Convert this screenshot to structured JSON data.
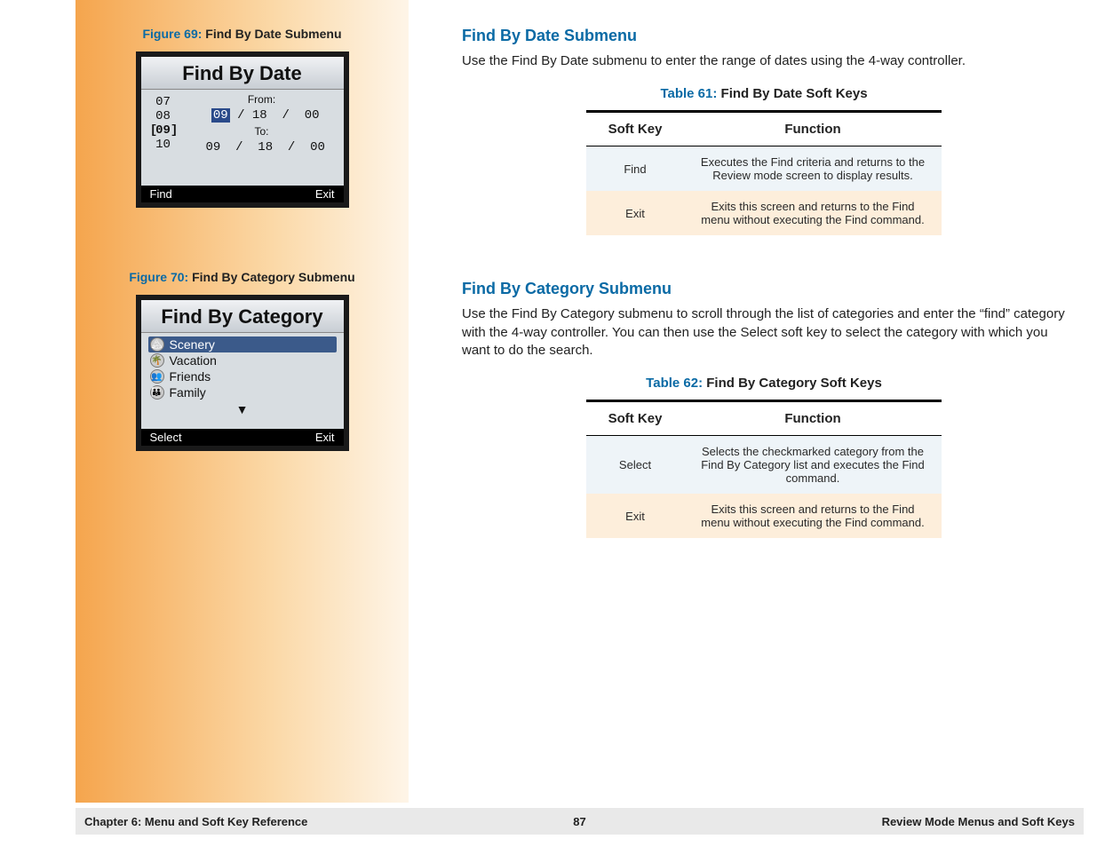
{
  "sidebar": {
    "figure69": {
      "label": "Figure 69:",
      "title": "Find By Date Submenu"
    },
    "figure70": {
      "label": "Figure 70:",
      "title": "Find By Category Submenu"
    },
    "screen1": {
      "title": "Find By Date",
      "wheel": [
        "07",
        "08",
        "09",
        "10"
      ],
      "from_label": "From:",
      "to_label": "To:",
      "from_date": {
        "m": "09",
        "d": "18",
        "y": "00"
      },
      "to_date": {
        "m": "09",
        "d": "18",
        "y": "00"
      },
      "sep": "/",
      "left_key": "Find",
      "right_key": "Exit"
    },
    "screen2": {
      "title": "Find By Category",
      "items": [
        "Scenery",
        "Vacation",
        "Friends",
        "Family"
      ],
      "left_key": "Select",
      "right_key": "Exit",
      "arrow": "▼"
    }
  },
  "content": {
    "section1": {
      "title": "Find By Date Submenu",
      "text": "Use the Find By Date submenu to enter the range of dates using the 4-way controller."
    },
    "table61": {
      "label": "Table 61:",
      "title": "Find By Date Soft Keys",
      "header": {
        "col1": "Soft Key",
        "col2": "Function"
      },
      "rows": [
        {
          "key": "Find",
          "func": "Executes the Find criteria and returns to the Review mode screen to display results."
        },
        {
          "key": "Exit",
          "func": "Exits this screen and returns to the Find menu without executing the Find command."
        }
      ]
    },
    "section2": {
      "title": "Find By Category Submenu",
      "text": "Use the Find By Category submenu to scroll through the list of categories and enter the “find” category with the 4-way controller. You can then use the Select soft key to select the category with which you want to do the search."
    },
    "table62": {
      "label": "Table 62:",
      "title": "Find By Category Soft Keys",
      "header": {
        "col1": "Soft Key",
        "col2": "Function"
      },
      "rows": [
        {
          "key": "Select",
          "func": "Selects the checkmarked category from the Find By Category list and executes the Find command."
        },
        {
          "key": "Exit",
          "func": "Exits this screen and returns to the Find menu without executing the Find command."
        }
      ]
    }
  },
  "footer": {
    "left": "Chapter 6: Menu and Soft Key Reference",
    "center": "87",
    "right": "Review Mode Menus and Soft Keys"
  }
}
